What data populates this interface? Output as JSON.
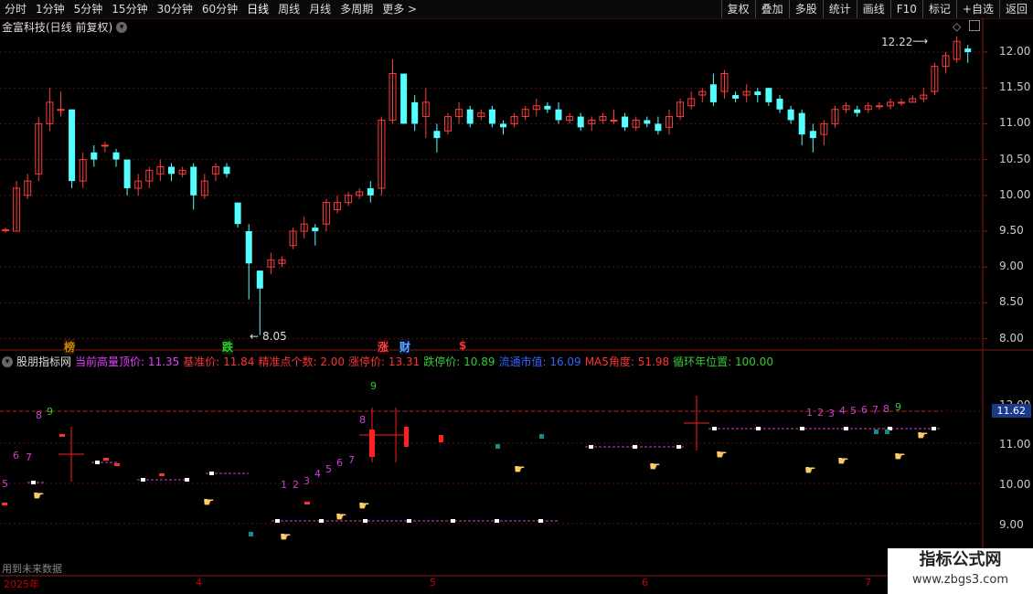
{
  "topbar": {
    "periods": [
      "分时",
      "1分钟",
      "5分钟",
      "15分钟",
      "30分钟",
      "60分钟",
      "日线",
      "周线",
      "月线",
      "多周期",
      "更多 >"
    ],
    "active_period": "日线",
    "tools": [
      "复权",
      "叠加",
      "多股",
      "统计",
      "画线",
      "F10",
      "+自选",
      "返回"
    ]
  },
  "chart": {
    "title": "金富科技(日线 前复权)",
    "mark_label": "标记",
    "price_axis": [
      "12.00",
      "11.50",
      "11.00",
      "10.50",
      "10.00",
      "9.50",
      "9.00",
      "8.50",
      "8.00"
    ],
    "high_label": "12.22",
    "low_label": "8.05",
    "event_markers": [
      "榜",
      "跌",
      "涨",
      "财",
      "$"
    ]
  },
  "indicator": {
    "name": "股朋指标网",
    "items": [
      {
        "label": "当前高量顶价:",
        "value": "11.35",
        "color": "#e040fb"
      },
      {
        "label": "基准价:",
        "value": "11.84",
        "color": "#ff3333"
      },
      {
        "label": "精准点个数:",
        "value": "2.00",
        "color": "#ff3333"
      },
      {
        "label": "涨停价:",
        "value": "13.31",
        "color": "#ff3333"
      },
      {
        "label": "跌停价:",
        "value": "10.89",
        "color": "#33cc33"
      },
      {
        "label": "流通市值:",
        "value": "16.09",
        "color": "#3366ff"
      },
      {
        "label": "MA5角度:",
        "value": "51.98",
        "color": "#ff3333"
      },
      {
        "label": "循环年位置:",
        "value": "100.00",
        "color": "#33cc33"
      }
    ],
    "axis": [
      "11.00",
      "10.00",
      "9.00"
    ],
    "axis_top": "12.00",
    "current_badge": "11.62",
    "future_note": "用到未来数据"
  },
  "time_axis": [
    "2025年",
    "4",
    "5",
    "6",
    "7"
  ],
  "watermark": {
    "line1": "指标公式网",
    "line2": "www.zbgs3.com"
  },
  "colors": {
    "up": "#ff3b3b",
    "down": "#54ffff",
    "grid": "#8b1a1a"
  }
}
